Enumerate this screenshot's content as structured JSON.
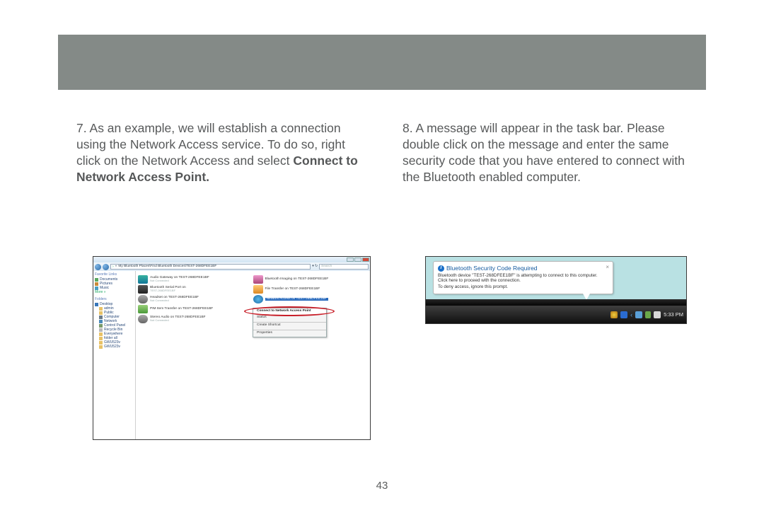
{
  "header_bar": "",
  "step7": {
    "number": "7.",
    "text_a": "As an example, we will establish a connection using the Network Access service.  To do so, right click on the Network Access and select ",
    "bold": "Connect to Network Access Point."
  },
  "step8": {
    "number": "8.",
    "text": "A message will appear in the task bar.  Please double click on the message and enter the same security code that you have entered to connect with the Bluetooth enabled computer."
  },
  "explorer": {
    "path": "My Bluetooth Places\\Find Bluetooth Devices\\TEST-268DFEE1BF",
    "search_placeholder": "Search",
    "favorites_header": "Favorite Links",
    "favorites": [
      "Documents",
      "Pictures",
      "Music"
    ],
    "more": "More »",
    "folders_header": "Folders",
    "folders": [
      "Desktop",
      "admin",
      "Public",
      "Computer",
      "Network",
      "Control Panel",
      "Recycle Bin",
      "Everywhere",
      "folder all",
      "GWU523v",
      "GWU523v"
    ],
    "items_left": [
      {
        "label": "Audio Gateway on TEST-268DFEE1BF",
        "sub": "Not Connected",
        "ic": "audio"
      },
      {
        "label": "Bluetooth Serial Port on",
        "sub": "TEST-268DFEE1BF",
        "ic": "serial"
      },
      {
        "label": "Headset on TEST-268DFEE1BF",
        "sub": "Not Connected",
        "ic": "headset"
      },
      {
        "label": "PIM Item Transfer on TEST-268DFEE1BF",
        "sub": "",
        "ic": "pim"
      },
      {
        "label": "Stereo Audio on TEST-268DFEE1BF",
        "sub": "Not Connected",
        "ic": "stereo"
      }
    ],
    "items_right": [
      {
        "label": "Bluetooth Imaging on TEST-268DFEE1BF",
        "sub": "",
        "ic": "imaging"
      },
      {
        "label": "File Transfer on TEST-268DFEE1BF",
        "sub": "",
        "ic": "ftp"
      },
      {
        "label": "Network Access on TEST-268DFEE1BF",
        "sub": "",
        "ic": "net",
        "selected": true
      }
    ],
    "context_menu": [
      "Connect to Network Access Point",
      "Status",
      "Create Shortcut",
      "Properties"
    ]
  },
  "notification": {
    "title": "Bluetooth Security Code Required",
    "line1": "Bluetooth device \"TEST-268DFEE1BF\" is attempting to connect to this computer.  Click here to proceed with the connection.",
    "line2": "To deny access, ignore this prompt.",
    "clock": "5:33 PM"
  },
  "page_number": "43"
}
